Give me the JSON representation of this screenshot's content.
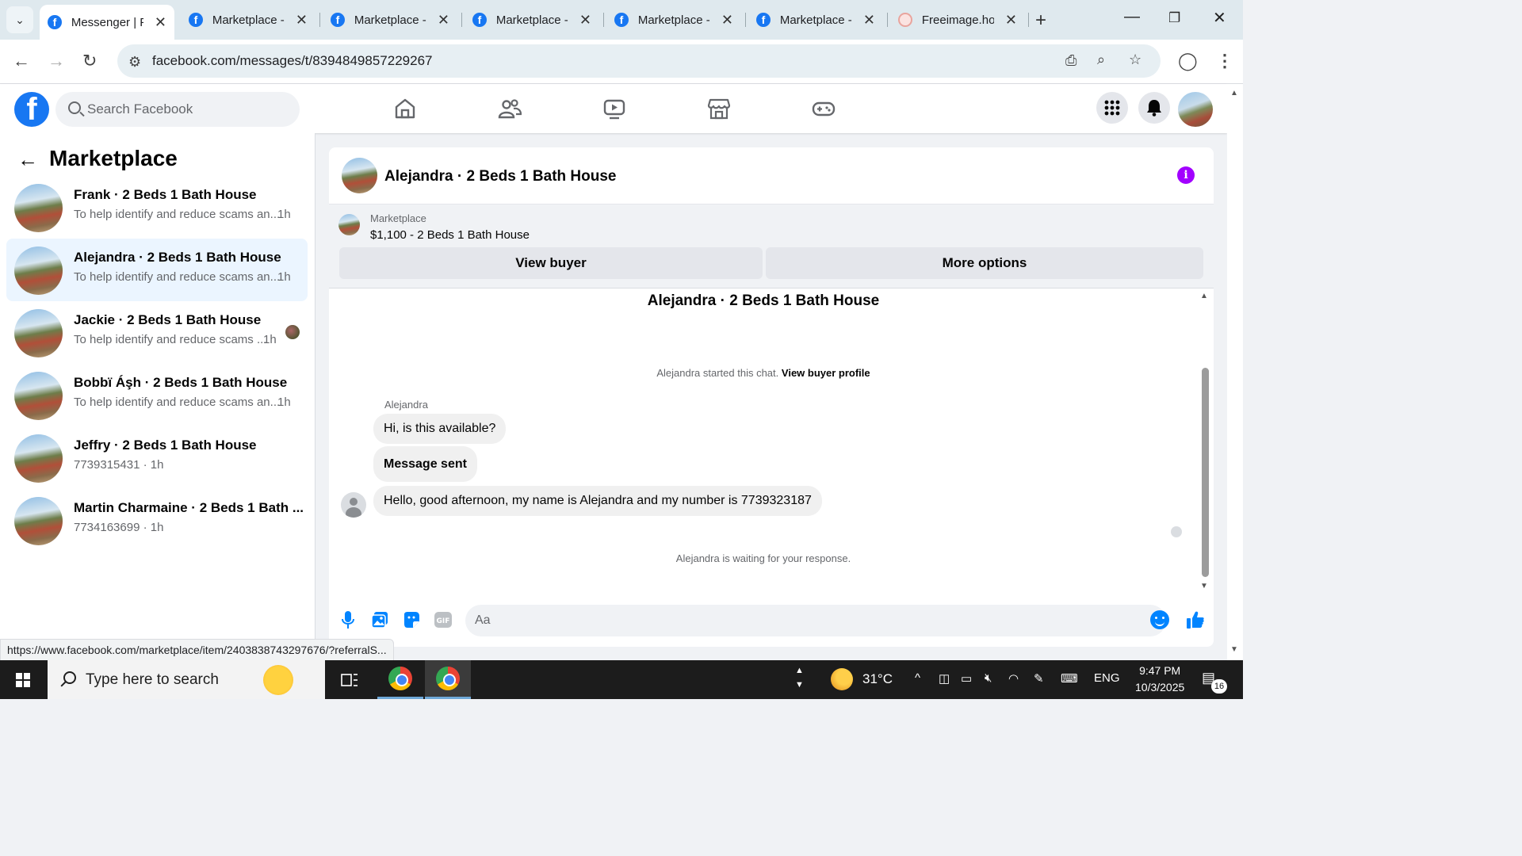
{
  "browser": {
    "tabs": [
      {
        "title": "Messenger | Fa",
        "favicon": "facebook-icon",
        "active": true
      },
      {
        "title": "Marketplace -",
        "favicon": "facebook-icon"
      },
      {
        "title": "Marketplace -",
        "favicon": "facebook-icon"
      },
      {
        "title": "Marketplace -",
        "favicon": "facebook-icon"
      },
      {
        "title": "Marketplace -",
        "favicon": "facebook-icon"
      },
      {
        "title": "Marketplace -",
        "favicon": "facebook-icon"
      },
      {
        "title": "Freeimage.ho",
        "favicon": "freeimage-icon"
      }
    ],
    "url": "facebook.com/messages/t/8394849857229267",
    "status_url": "https://www.facebook.com/marketplace/item/2403838743297676/?referralS..."
  },
  "facebook": {
    "search_placeholder": "Search Facebook",
    "brand_color": "#1877f2"
  },
  "left_panel": {
    "title": "Marketplace",
    "conversations": [
      {
        "name": "Frank · 2 Beds 1 Bath House",
        "preview": "To help identify and reduce scams an...",
        "time": "1h"
      },
      {
        "name": "Alejandra · 2 Beds 1 Bath House",
        "preview": "To help identify and reduce scams an...",
        "time": "1h",
        "selected": true
      },
      {
        "name": "Jackie · 2 Beds 1 Bath House",
        "preview": "To help identify and reduce scams ...",
        "time": "1h"
      },
      {
        "name": "Bobbï Áşh · 2 Beds 1 Bath House",
        "preview": "To help identify and reduce scams an...",
        "time": "1h"
      },
      {
        "name": "Jeffry · 2 Beds 1 Bath House",
        "preview": "7739315431 · 1h",
        "time": ""
      },
      {
        "name": "Martin Charmaine · 2 Beds 1 Bath ...",
        "preview": "7734163699 · 1h",
        "time": ""
      }
    ]
  },
  "chat": {
    "header_title": "Alejandra · 2 Beds 1 Bath House",
    "listing_source": "Marketplace",
    "listing_price": "$1,100 - 2 Beds 1 Bath House",
    "view_buyer": "View buyer",
    "more_options": "More options",
    "thread_title": "Alejandra · 2 Beds 1 Bath House",
    "started_text": "Alejandra started this chat.",
    "view_profile": "View buyer profile",
    "sender": "Alejandra",
    "messages": [
      "Hi, is this available?",
      "Message sent",
      "Hello, good afternoon, my name is Alejandra and my number is 7739323187"
    ],
    "waiting": "Alejandra is waiting for your response.",
    "composer_placeholder": "Aa",
    "accent": "#0084ff",
    "info_color": "#a200ff"
  },
  "taskbar": {
    "search_placeholder": "Type here to search",
    "temperature": "31°C",
    "language": "ENG",
    "time": "9:47 PM",
    "date": "10/3/2025",
    "notifications": "16"
  }
}
